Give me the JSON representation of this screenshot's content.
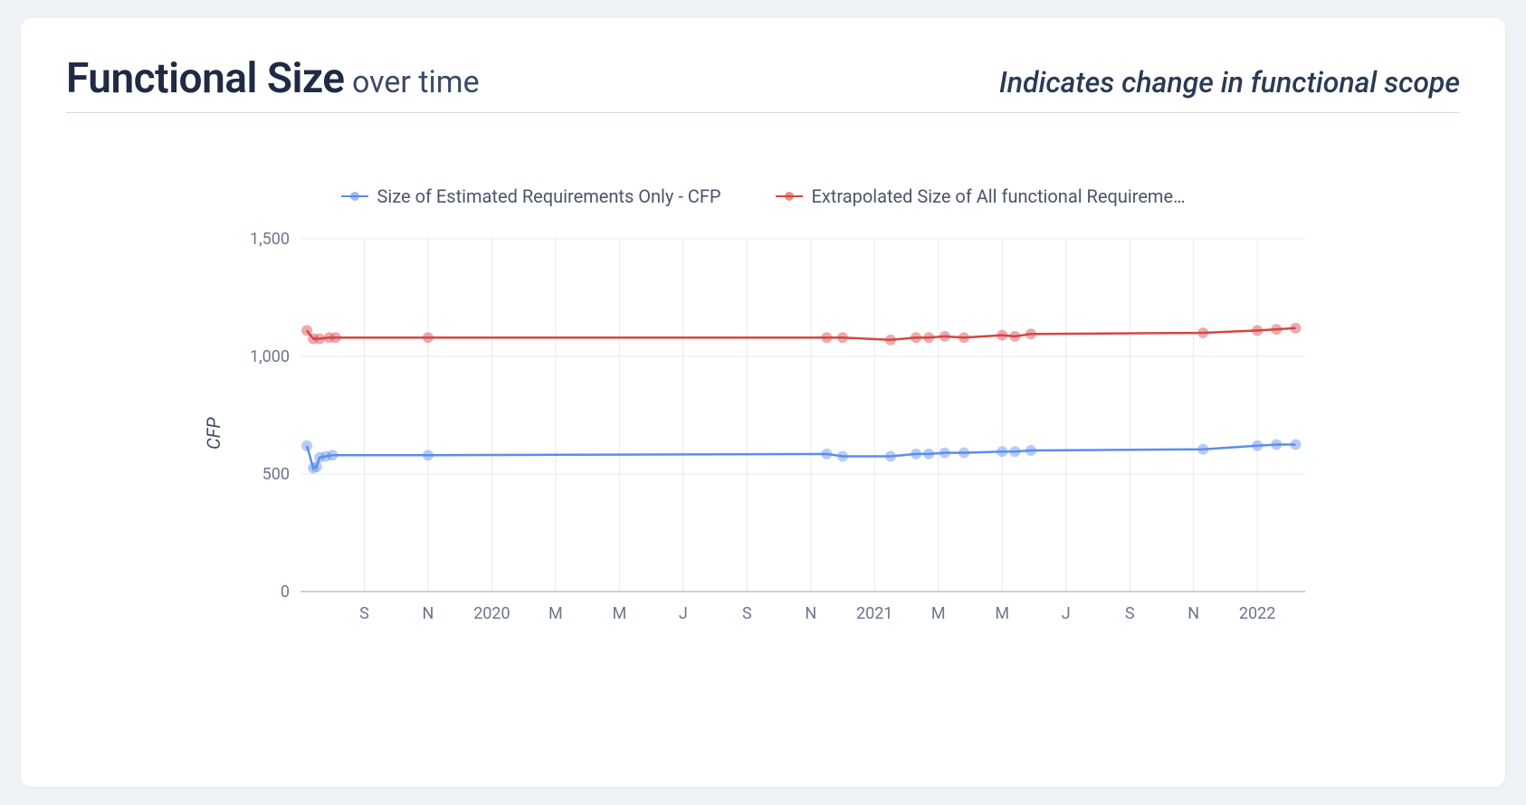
{
  "header": {
    "title_main": "Functional Size",
    "title_sub": " over time",
    "subtitle": "Indicates change in functional scope"
  },
  "legend": {
    "series1": "Size of Estimated Requirements Only - CFP",
    "series2": "Extrapolated Size of All functional Requireme…"
  },
  "chart_data": {
    "type": "line",
    "ylabel": "CFP",
    "xlabel": "",
    "ylim": [
      0,
      1500
    ],
    "y_ticks": [
      0,
      500,
      1000,
      1500
    ],
    "x_tick_labels": [
      "S",
      "N",
      "2020",
      "M",
      "M",
      "J",
      "S",
      "N",
      "2021",
      "M",
      "M",
      "J",
      "S",
      "N",
      "2022"
    ],
    "x_tick_positions": [
      2,
      4,
      6,
      8,
      10,
      12,
      14,
      16,
      18,
      20,
      22,
      24,
      26,
      28,
      30
    ],
    "x_range": [
      0,
      31.5
    ],
    "series": [
      {
        "name": "Size of Estimated Requirements Only - CFP",
        "color": "blue",
        "points": [
          {
            "x": 0.2,
            "y": 620
          },
          {
            "x": 0.4,
            "y": 525
          },
          {
            "x": 0.5,
            "y": 530
          },
          {
            "x": 0.6,
            "y": 570
          },
          {
            "x": 0.8,
            "y": 575
          },
          {
            "x": 1.0,
            "y": 580
          },
          {
            "x": 4.0,
            "y": 580
          },
          {
            "x": 16.5,
            "y": 585
          },
          {
            "x": 17.0,
            "y": 575
          },
          {
            "x": 18.5,
            "y": 575
          },
          {
            "x": 19.3,
            "y": 585
          },
          {
            "x": 19.7,
            "y": 585
          },
          {
            "x": 20.2,
            "y": 590
          },
          {
            "x": 20.8,
            "y": 590
          },
          {
            "x": 22.0,
            "y": 595
          },
          {
            "x": 22.4,
            "y": 595
          },
          {
            "x": 22.9,
            "y": 600
          },
          {
            "x": 28.3,
            "y": 605
          },
          {
            "x": 30.0,
            "y": 620
          },
          {
            "x": 30.6,
            "y": 625
          },
          {
            "x": 31.2,
            "y": 625
          }
        ]
      },
      {
        "name": "Extrapolated Size of All functional Requirements - CFP",
        "color": "red",
        "points": [
          {
            "x": 0.2,
            "y": 1110
          },
          {
            "x": 0.4,
            "y": 1075
          },
          {
            "x": 0.6,
            "y": 1075
          },
          {
            "x": 0.9,
            "y": 1080
          },
          {
            "x": 1.1,
            "y": 1080
          },
          {
            "x": 4.0,
            "y": 1080
          },
          {
            "x": 16.5,
            "y": 1080
          },
          {
            "x": 17.0,
            "y": 1080
          },
          {
            "x": 18.5,
            "y": 1070
          },
          {
            "x": 19.3,
            "y": 1080
          },
          {
            "x": 19.7,
            "y": 1080
          },
          {
            "x": 20.2,
            "y": 1085
          },
          {
            "x": 20.8,
            "y": 1080
          },
          {
            "x": 22.0,
            "y": 1090
          },
          {
            "x": 22.4,
            "y": 1085
          },
          {
            "x": 22.9,
            "y": 1095
          },
          {
            "x": 28.3,
            "y": 1100
          },
          {
            "x": 30.0,
            "y": 1110
          },
          {
            "x": 30.6,
            "y": 1115
          },
          {
            "x": 31.2,
            "y": 1120
          }
        ]
      }
    ]
  }
}
